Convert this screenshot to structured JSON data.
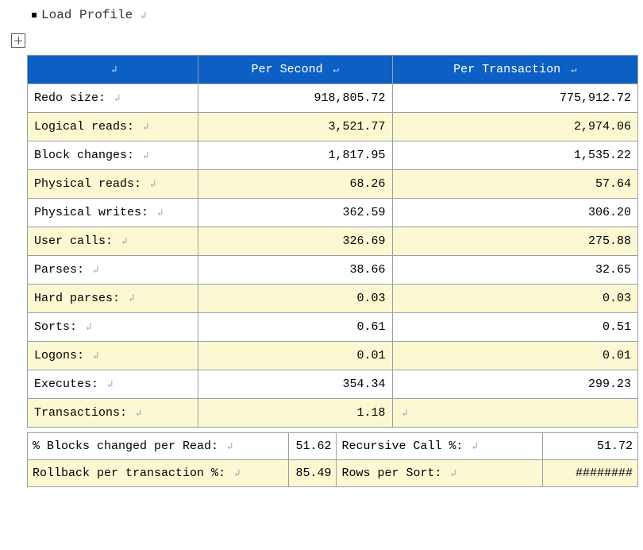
{
  "heading": "Load Profile",
  "columns": {
    "c0": "",
    "c1": "Per Second",
    "c2": "Per Transaction"
  },
  "rows": [
    {
      "label": "Redo size:",
      "sec": "918,805.72",
      "txn": "775,912.72"
    },
    {
      "label": "Logical reads:",
      "sec": "3,521.77",
      "txn": "2,974.06"
    },
    {
      "label": "Block changes:",
      "sec": "1,817.95",
      "txn": "1,535.22"
    },
    {
      "label": "Physical reads:",
      "sec": "68.26",
      "txn": "57.64"
    },
    {
      "label": "Physical writes:",
      "sec": "362.59",
      "txn": "306.20"
    },
    {
      "label": "User calls:",
      "sec": "326.69",
      "txn": "275.88"
    },
    {
      "label": "Parses:",
      "sec": "38.66",
      "txn": "32.65"
    },
    {
      "label": "Hard parses:",
      "sec": "0.03",
      "txn": "0.03"
    },
    {
      "label": "Sorts:",
      "sec": "0.61",
      "txn": "0.51"
    },
    {
      "label": "Logons:",
      "sec": "0.01",
      "txn": "0.01"
    },
    {
      "label": "Executes:",
      "sec": "354.34",
      "txn": "299.23"
    },
    {
      "label": "Transactions:",
      "sec": "1.18",
      "txn": ""
    }
  ],
  "summary": [
    {
      "l1": "% Blocks changed per Read:",
      "v1": "51.62",
      "l2": "Recursive Call %:",
      "v2": "51.72"
    },
    {
      "l1": "Rollback per transaction %:",
      "v1": "85.49",
      "l2": "Rows per Sort:",
      "v2": "########"
    }
  ]
}
